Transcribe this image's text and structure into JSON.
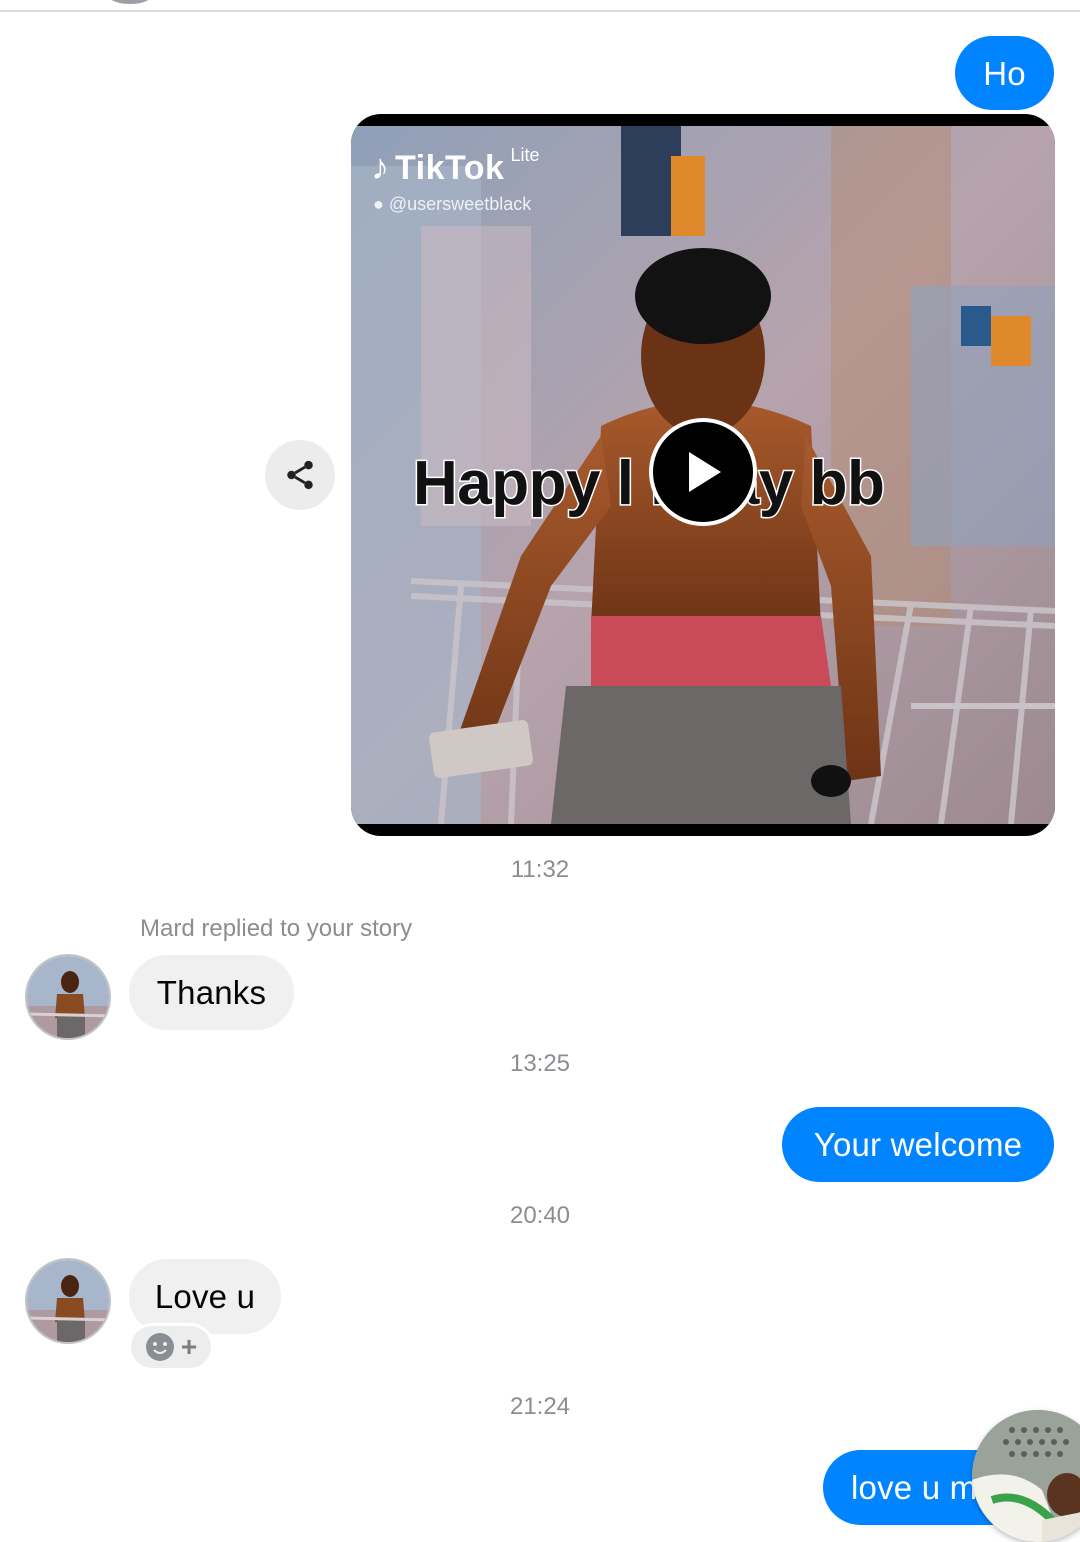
{
  "messages": {
    "ho": "Ho",
    "thanks": "Thanks",
    "your_welcome": "Your welcome",
    "love_u": "Love u",
    "love_u_m": "love u m"
  },
  "video_card": {
    "app_name": "TikTok",
    "app_variant": "Lite",
    "username": "@usersweetblack",
    "overlay_text": "Happy l     nday bb"
  },
  "timestamps": [
    "11:32",
    "13:25",
    "20:40",
    "21:24"
  ],
  "reply_caption": "Mard replied to your story",
  "colors": {
    "outgoing_bubble": "#0084ff",
    "incoming_bubble": "#f0f0f0",
    "timestamp_text": "#8a8d91"
  },
  "icons": {
    "share": "share-icon",
    "play": "play-icon",
    "reaction": "smiley-icon",
    "add_reaction": "plus-icon"
  }
}
